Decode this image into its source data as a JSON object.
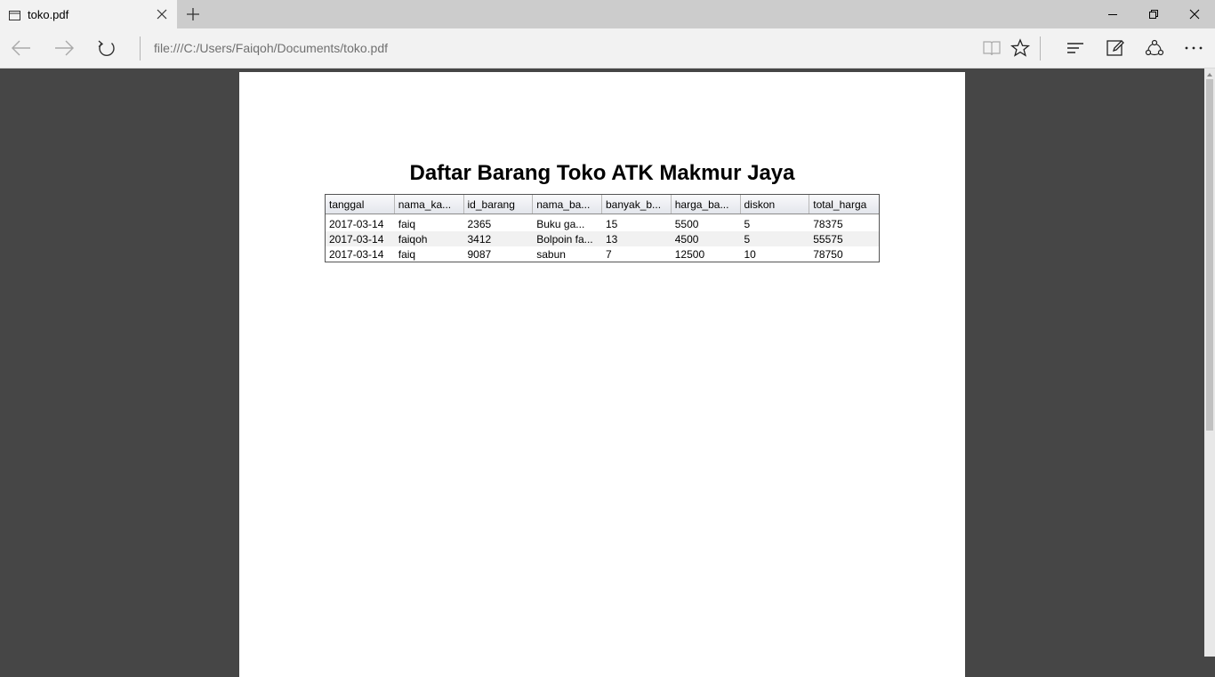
{
  "tab": {
    "title": "toko.pdf"
  },
  "address_bar": {
    "url": "file:///C:/Users/Faiqoh/Documents/toko.pdf"
  },
  "icons": {
    "tab": "tab-page-icon",
    "close_tab": "close-icon",
    "new_tab": "plus-icon",
    "minimize": "minimize-icon",
    "restore": "restore-icon",
    "close_window": "close-icon",
    "back": "back-arrow-icon",
    "forward": "forward-arrow-icon",
    "refresh": "refresh-icon",
    "reading_view": "book-icon",
    "favorite": "star-icon",
    "hub": "hub-icon",
    "web_note": "pen-icon",
    "share": "share-icon",
    "more": "ellipsis-icon"
  },
  "document": {
    "title": "Daftar Barang Toko ATK Makmur Jaya",
    "table": {
      "columns": [
        "tanggal",
        "nama_ka...",
        "id_barang",
        "nama_ba...",
        "banyak_b...",
        "harga_ba...",
        "diskon",
        "total_harga"
      ],
      "rows": [
        [
          "2017-03-14",
          "faiq",
          "2365",
          "Buku ga...",
          "15",
          "5500",
          "5",
          "78375"
        ],
        [
          "2017-03-14",
          "faiqoh",
          "3412",
          "Bolpoin fa...",
          "13",
          "4500",
          "5",
          "55575"
        ],
        [
          "2017-03-14",
          "faiq",
          "9087",
          "sabun",
          "7",
          "12500",
          "10",
          "78750"
        ]
      ]
    }
  },
  "colors": {
    "viewer_background": "#464646",
    "tabstrip": "#cccccc",
    "toolbar": "#f2f2f2",
    "page": "#ffffff"
  }
}
